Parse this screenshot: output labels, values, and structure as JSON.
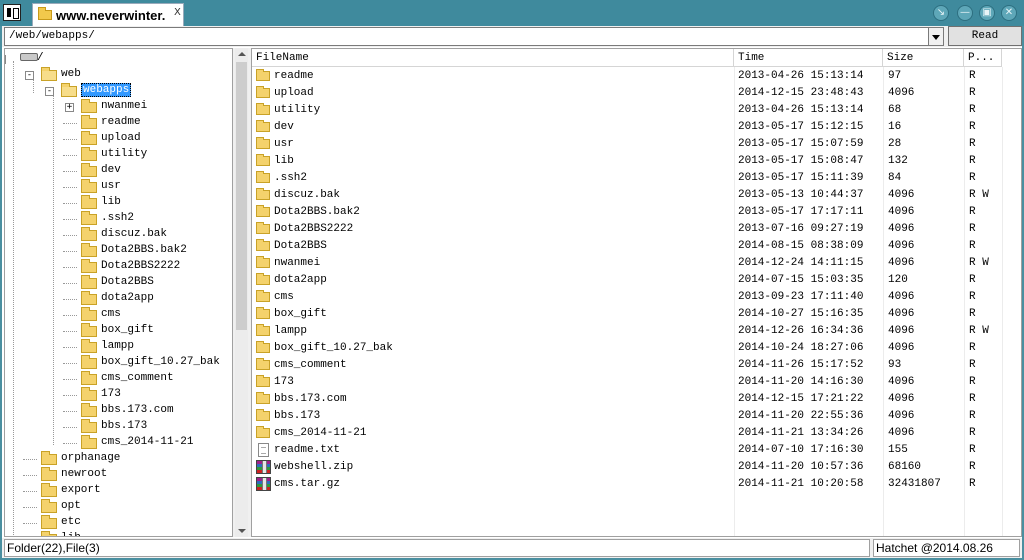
{
  "window": {
    "tab_title": "www.neverwinter.",
    "tab_close": "X"
  },
  "pathbar": {
    "path": "/web/webapps/",
    "read_label": "Read"
  },
  "tree": {
    "root": "/",
    "web": "web",
    "webapps": "webapps",
    "webapps_children": [
      "nwanmei",
      "readme",
      "upload",
      "utility",
      "dev",
      "usr",
      "lib",
      ".ssh2",
      "discuz.bak",
      "Dota2BBS.bak2",
      "Dota2BBS2222",
      "Dota2BBS",
      "dota2app",
      "cms",
      "box_gift",
      "lampp",
      "box_gift_10.27_bak",
      "cms_comment",
      "173",
      "bbs.173.com",
      "bbs.173",
      "cms_2014-11-21"
    ],
    "root_children": [
      "orphanage",
      "newroot",
      "export",
      "opt",
      "etc",
      "lib"
    ]
  },
  "list": {
    "columns": [
      "FileName",
      "Time",
      "Size",
      "P..."
    ],
    "rows": [
      {
        "name": "readme",
        "time": "2013-04-26 15:13:14",
        "size": "97",
        "perm": "R",
        "type": "folder"
      },
      {
        "name": "upload",
        "time": "2014-12-15 23:48:43",
        "size": "4096",
        "perm": "R",
        "type": "folder"
      },
      {
        "name": "utility",
        "time": "2013-04-26 15:13:14",
        "size": "68",
        "perm": "R",
        "type": "folder"
      },
      {
        "name": "dev",
        "time": "2013-05-17 15:12:15",
        "size": "16",
        "perm": "R",
        "type": "folder"
      },
      {
        "name": "usr",
        "time": "2013-05-17 15:07:59",
        "size": "28",
        "perm": "R",
        "type": "folder"
      },
      {
        "name": "lib",
        "time": "2013-05-17 15:08:47",
        "size": "132",
        "perm": "R",
        "type": "folder"
      },
      {
        "name": ".ssh2",
        "time": "2013-05-17 15:11:39",
        "size": "84",
        "perm": "R",
        "type": "folder"
      },
      {
        "name": "discuz.bak",
        "time": "2013-05-13 10:44:37",
        "size": "4096",
        "perm": "R W",
        "type": "folder"
      },
      {
        "name": "Dota2BBS.bak2",
        "time": "2013-05-17 17:17:11",
        "size": "4096",
        "perm": "R",
        "type": "folder"
      },
      {
        "name": "Dota2BBS2222",
        "time": "2013-07-16 09:27:19",
        "size": "4096",
        "perm": "R",
        "type": "folder"
      },
      {
        "name": "Dota2BBS",
        "time": "2014-08-15 08:38:09",
        "size": "4096",
        "perm": "R",
        "type": "folder"
      },
      {
        "name": "nwanmei",
        "time": "2014-12-24 14:11:15",
        "size": "4096",
        "perm": "R W",
        "type": "folder"
      },
      {
        "name": "dota2app",
        "time": "2014-07-15 15:03:35",
        "size": "120",
        "perm": "R",
        "type": "folder"
      },
      {
        "name": "cms",
        "time": "2013-09-23 17:11:40",
        "size": "4096",
        "perm": "R",
        "type": "folder"
      },
      {
        "name": "box_gift",
        "time": "2014-10-27 15:16:35",
        "size": "4096",
        "perm": "R",
        "type": "folder"
      },
      {
        "name": "lampp",
        "time": "2014-12-26 16:34:36",
        "size": "4096",
        "perm": "R W",
        "type": "folder"
      },
      {
        "name": "box_gift_10.27_bak",
        "time": "2014-10-24 18:27:06",
        "size": "4096",
        "perm": "R",
        "type": "folder"
      },
      {
        "name": "cms_comment",
        "time": "2014-11-26 15:17:52",
        "size": "93",
        "perm": "R",
        "type": "folder"
      },
      {
        "name": "173",
        "time": "2014-11-20 14:16:30",
        "size": "4096",
        "perm": "R",
        "type": "folder"
      },
      {
        "name": "bbs.173.com",
        "time": "2014-12-15 17:21:22",
        "size": "4096",
        "perm": "R",
        "type": "folder"
      },
      {
        "name": "bbs.173",
        "time": "2014-11-20 22:55:36",
        "size": "4096",
        "perm": "R",
        "type": "folder"
      },
      {
        "name": "cms_2014-11-21",
        "time": "2014-11-21 13:34:26",
        "size": "4096",
        "perm": "R",
        "type": "folder"
      },
      {
        "name": "readme.txt",
        "time": "2014-07-10 17:16:30",
        "size": "155",
        "perm": "R",
        "type": "text"
      },
      {
        "name": "webshell.zip",
        "time": "2014-11-20 10:57:36",
        "size": "68160",
        "perm": "R",
        "type": "archive"
      },
      {
        "name": "cms.tar.gz",
        "time": "2014-11-21 10:20:58",
        "size": "32431807",
        "perm": "R",
        "type": "archive"
      }
    ]
  },
  "status": {
    "left": "Folder(22),File(3)",
    "right": "Hatchet @2014.08.26"
  },
  "colors": {
    "titlebar": "#3f8a9d",
    "selection": "#3399ff",
    "folder": "#f4d26c"
  }
}
